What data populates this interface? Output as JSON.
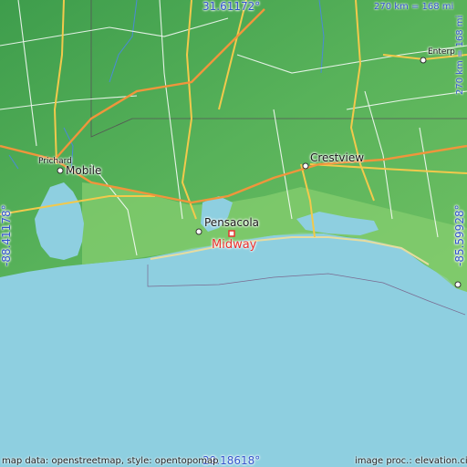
{
  "coords": {
    "top": "31.61172°",
    "bottom": "29.18618°",
    "left": "-88.41178°",
    "right": "-85.59928°"
  },
  "scale": {
    "horizontal": "270 km = 168 mi",
    "vertical": "270 km = 168 mi"
  },
  "places": {
    "prichard": "Prichard",
    "mobile": "Mobile",
    "pensacola": "Pensacola",
    "midway": "Midway",
    "crestview": "Crestview",
    "enterprise": "Enterp"
  },
  "credits": {
    "left": "map data: openstreetmap, style: opentopomap",
    "right": "image proc.: elevation.city"
  },
  "colors": {
    "water": "#8ecfe0",
    "land_low": "#7fc96b",
    "land_high": "#3fa04f",
    "road_major": "#f2c94c",
    "road_orange": "#f0953c",
    "highlight": "#e8322f"
  }
}
